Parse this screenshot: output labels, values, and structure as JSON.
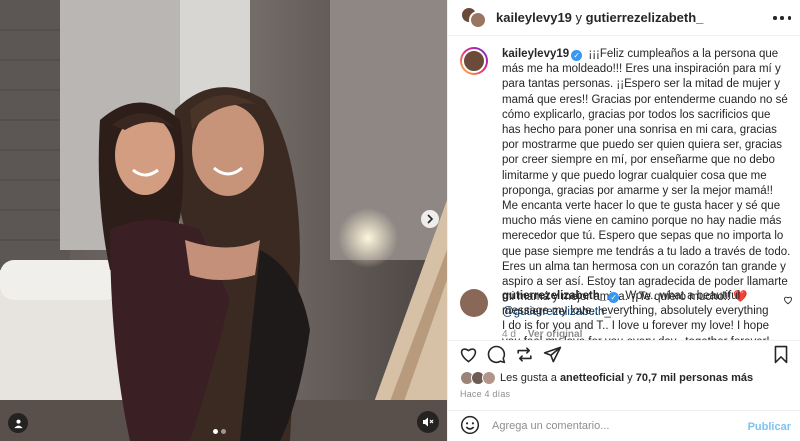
{
  "header": {
    "user1": "kaileylevy19",
    "joiner": " y ",
    "user2": "gutierrezelizabeth_"
  },
  "caption": {
    "username": "kaileylevy19",
    "text": "¡¡¡Feliz cumpleaños a la persona que más me ha moldeado!!! Eres una inspiración para mí y para tantas personas. ¡¡Espero ser la mitad de mujer y mamá que eres!! Gracias por entenderme cuando no sé cómo explicarlo, gracias por todos los sacrificios que has hecho para poner una sonrisa en mi cara, gracias por mostrarme que puedo ser quien quiera ser, gracias por creer siempre en mí, por enseñarme que no debo limitarme y que puedo lograr cualquier cosa que me proponga, gracias por amarme y ser la mejor mamá!! Me encanta verte hacer lo que te gusta hacer y sé que mucho más viene en camino porque no hay nadie más merecedor que tú. Espero que sepas que no importa lo que pase siempre me tendrás a tu lado a través de todo. Eres un alma tan hermosa con un corazón tan grande y aspiro a ser así. Estoy tan agradecida de poder llamarte mi mamá y mejor amiga. ¡¡Te quiero mucho!! ❤️ ",
    "mention": "@gutierrezelizabeth_",
    "age": "4 d",
    "translate": "Ver original"
  },
  "reply": {
    "username": "gutierrezelizabeth_",
    "text": "Wow.. what a beautiful message my love.. everything, absolutely everything I do is for you and T.. I love u forever my love! I hope you feel my love for you every day...together forever! 🤗💝🙏"
  },
  "likes": {
    "prefix": "Les gusta a ",
    "user": "anetteoficial",
    "middle": " y ",
    "count": "70,7 mil personas más"
  },
  "date": "Hace 4 días",
  "composer": {
    "placeholder": "Agrega un comentario...",
    "post_label": "Publicar"
  },
  "carousel": {
    "slides": 2,
    "active": 1
  },
  "icons": [
    "tag-icon",
    "next-icon",
    "mute-icon",
    "more-icon",
    "heart-icon",
    "comment-icon",
    "share-icon",
    "save-icon",
    "emoji-icon",
    "verified-icon"
  ]
}
